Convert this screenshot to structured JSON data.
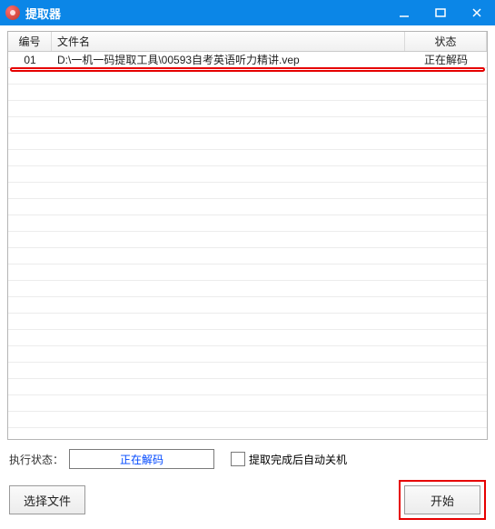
{
  "titlebar": {
    "title": "提取器"
  },
  "columns": {
    "no": "编号",
    "file": "文件名",
    "status": "状态"
  },
  "rows": [
    {
      "no": "01",
      "file": "D:\\一机一码提取工具\\00593自考英语听力精讲.vep",
      "status": "正在解码"
    }
  ],
  "footer": {
    "status_label": "执行状态：",
    "status_value": "正在解码",
    "shutdown_label": "提取完成后自动关机",
    "select_file": "选择文件",
    "start": "开始"
  }
}
